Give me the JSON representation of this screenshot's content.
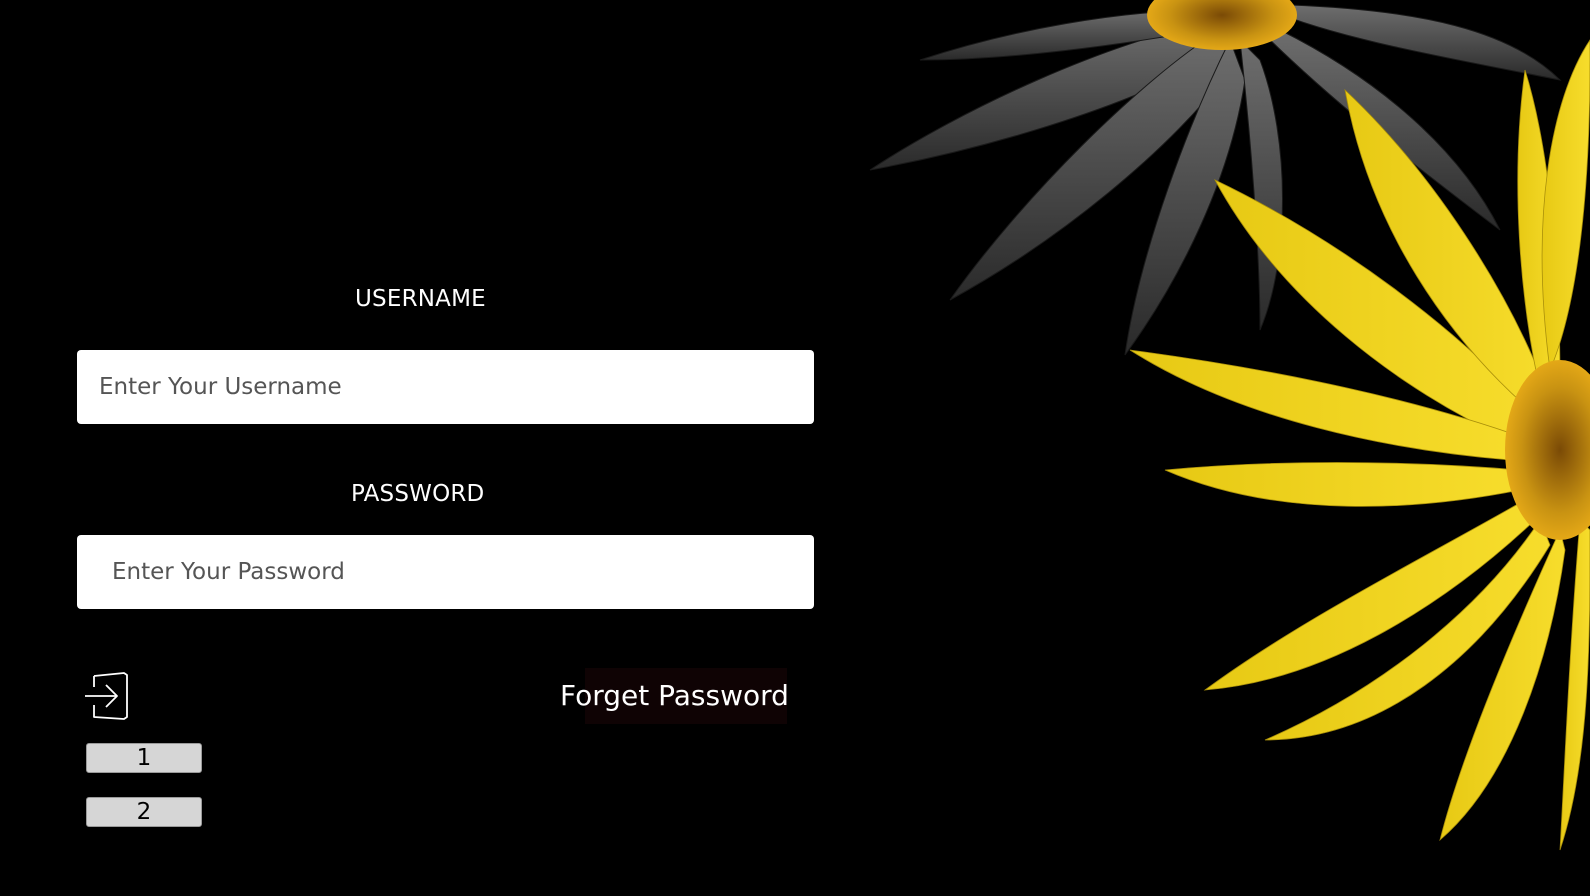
{
  "form": {
    "username_label": "USERNAME",
    "username_placeholder": "Enter Your Username",
    "username_value": "",
    "password_label": "PASSWORD",
    "password_placeholder": "Enter Your Password",
    "password_value": "",
    "signin_icon": "sign-in-arrow-icon",
    "forget_password_label": "Forget Password"
  },
  "buttons": {
    "one_label": "1",
    "two_label": "2"
  },
  "decoration": {
    "image": "sunflower-photo",
    "colors": {
      "background": "#000000",
      "petal_yellow": "#f2d21a",
      "petal_grey": "#5a5a5a",
      "center_orange": "#c9910f"
    }
  }
}
